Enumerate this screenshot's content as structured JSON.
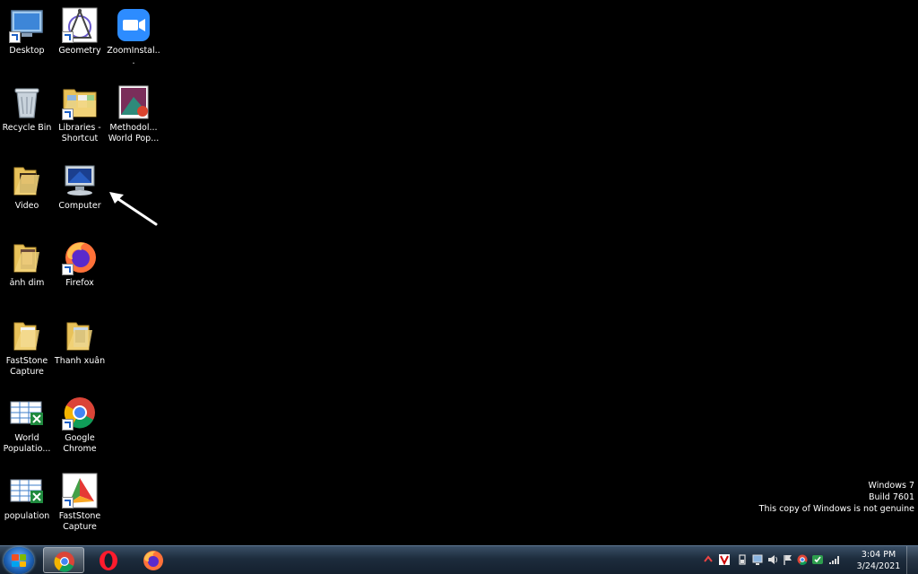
{
  "desktop_icons": [
    {
      "id": "desktop",
      "label": "Desktop",
      "icon": "desktop-monitor-icon"
    },
    {
      "id": "geometry",
      "label": "Geometry",
      "icon": "geometry-app-icon"
    },
    {
      "id": "zoom",
      "label": "ZoomInstal...",
      "icon": "zoom-camera-icon"
    },
    {
      "id": "recycle",
      "label": "Recycle Bin",
      "icon": "recycle-bin-icon"
    },
    {
      "id": "libraries",
      "label": "Libraries -\nShortcut",
      "icon": "libraries-folder-icon"
    },
    {
      "id": "methodol",
      "label": "Methodol...\nWorld Pop...",
      "icon": "pdf-document-icon"
    },
    {
      "id": "video",
      "label": "Video",
      "icon": "folder-icon"
    },
    {
      "id": "computer",
      "label": "Computer",
      "icon": "computer-icon"
    },
    {
      "id": "anh",
      "label": "ảnh dim",
      "icon": "folder-icon"
    },
    {
      "id": "firefox",
      "label": "Firefox",
      "icon": "firefox-icon"
    },
    {
      "id": "faststone1",
      "label": "FastStone\nCapture",
      "icon": "folder-icon"
    },
    {
      "id": "thanh",
      "label": "Thanh xuân",
      "icon": "folder-icon"
    },
    {
      "id": "worldpop",
      "label": "World\nPopulatio...",
      "icon": "excel-file-icon"
    },
    {
      "id": "chrome",
      "label": "Google\nChrome",
      "icon": "chrome-icon"
    },
    {
      "id": "population",
      "label": "population",
      "icon": "excel-file-icon"
    },
    {
      "id": "faststone2",
      "label": "FastStone\nCapture",
      "icon": "faststone-capture-icon"
    }
  ],
  "watermark": {
    "line1": "Windows 7",
    "line2": "Build 7601",
    "line3": "This copy of Windows is not genuine"
  },
  "taskbar": {
    "pinned": [
      {
        "name": "chrome",
        "icon": "chrome-icon",
        "active": true
      },
      {
        "name": "opera",
        "icon": "opera-icon",
        "active": false
      },
      {
        "name": "firefox",
        "icon": "firefox-icon",
        "active": false
      }
    ],
    "clock": {
      "time": "3:04 PM",
      "date": "3/24/2021"
    }
  },
  "colors": {
    "desktop_bg": "#000000",
    "taskbar": "#1d2c3d",
    "accent": "#1e63b8"
  }
}
